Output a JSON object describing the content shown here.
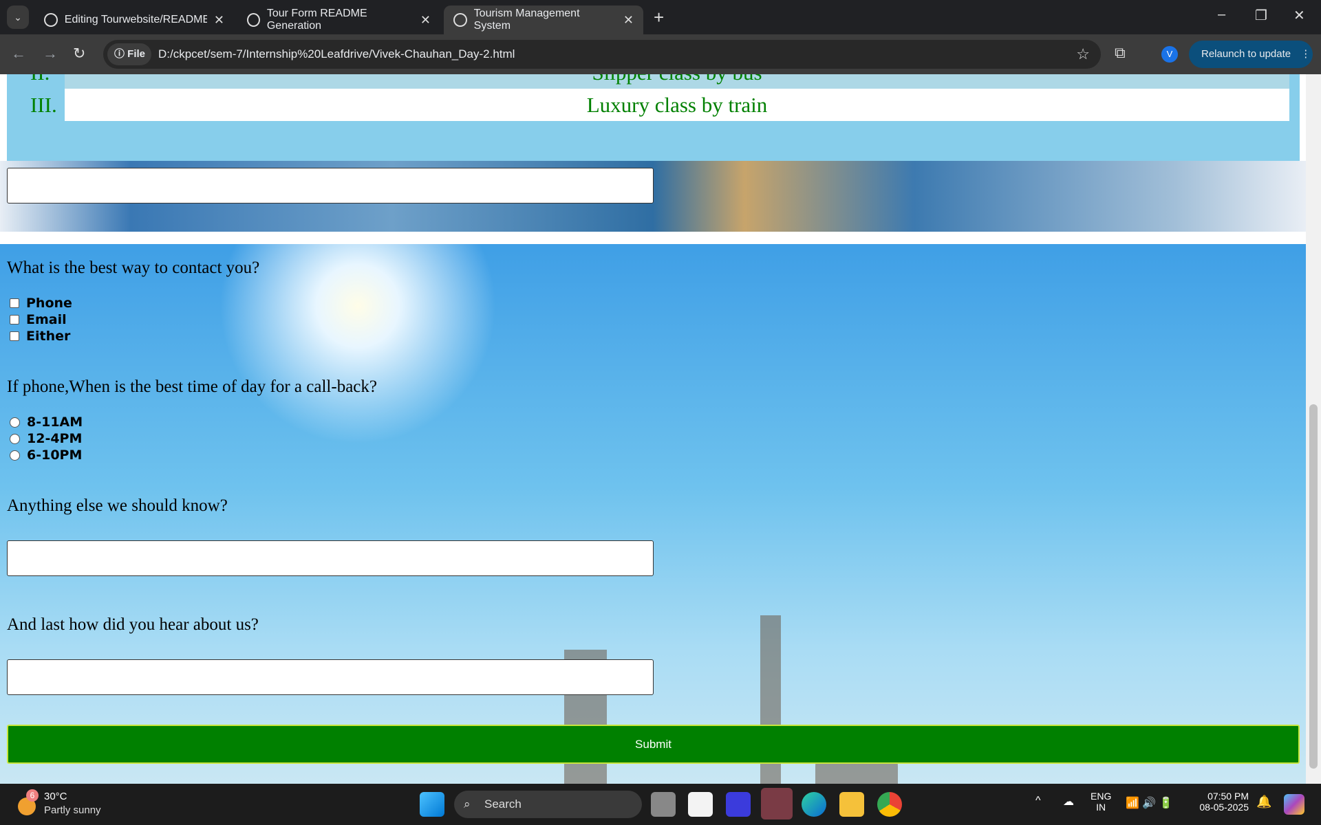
{
  "browser": {
    "tabs": [
      {
        "title": "Editing Tourwebsite/README.m",
        "icon": "github-icon"
      },
      {
        "title": "Tour Form README Generation",
        "icon": "chatgpt-icon"
      },
      {
        "title": "Tourism Management System",
        "icon": "globe-icon",
        "active": true
      }
    ],
    "chip": "File",
    "url": "D:/ckpcet/sem-7/Internship%20Leafdrive/Vivek-Chauhan_Day-2.html",
    "avatar": "V",
    "relaunch": "Relaunch to update"
  },
  "page": {
    "list": [
      {
        "num": "II.",
        "text": "Slipper class by bus"
      },
      {
        "num": "III.",
        "text": "Luxury class by train"
      }
    ],
    "q_contact": "What is the best way to contact you?",
    "contact_options": [
      "Phone",
      "Email",
      "Either"
    ],
    "q_time": "If phone,When is the best time of day for a call-back?",
    "time_options": [
      "8-11AM",
      "12-4PM",
      "6-10PM"
    ],
    "q_else": "Anything else we should know?",
    "q_hear": "And last how did you hear about us?",
    "submit": "Submit"
  },
  "taskbar": {
    "weather_badge": "6",
    "temp": "30°C",
    "weather": "Partly sunny",
    "search": "Search",
    "lang1": "ENG",
    "lang2": "IN",
    "time": "07:50 PM",
    "date": "08-05-2025"
  }
}
